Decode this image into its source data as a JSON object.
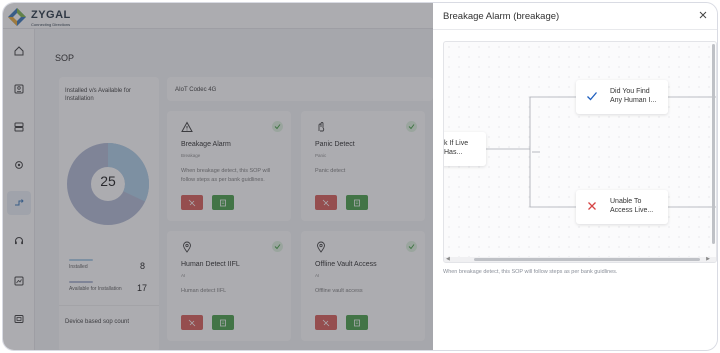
{
  "app": {
    "brand": "ZYGAL",
    "tagline": "Connecting Directions"
  },
  "sidebar": {
    "items": [
      {
        "icon": "home-icon"
      },
      {
        "icon": "id-card-icon"
      },
      {
        "icon": "server-icon"
      },
      {
        "icon": "gear-icon"
      },
      {
        "icon": "workflow-icon",
        "active": true
      },
      {
        "icon": "headset-icon"
      },
      {
        "icon": "report-icon"
      },
      {
        "icon": "device-icon"
      }
    ]
  },
  "main": {
    "title": "SOP",
    "stats": {
      "title": "Installed v/s Available for Installation",
      "total": "25",
      "installed_label": "Installed",
      "installed_value": "8",
      "available_label": "Available for Installation",
      "available_value": "17",
      "installed_fraction": 0.32,
      "installed_color": "#a9cce6",
      "available_color": "#aeb7d2",
      "device_title": "Device based sop count"
    },
    "codec_title": "AIoT Codec 4G",
    "cards": [
      {
        "name": "Breakage Alarm",
        "sub": "Breakage",
        "desc": "When breakage detect, this SOP will follow steps as per bank guidlines.",
        "icon": "warning-icon"
      },
      {
        "name": "Panic Detect",
        "sub": "Panic",
        "desc": "Panic detect",
        "icon": "hand-icon"
      },
      {
        "name": "Human Detect IIFL",
        "sub": "AI",
        "desc": "Human detect IIFL",
        "icon": "location-pin-icon"
      },
      {
        "name": "Offline Vault Access",
        "sub": "AI",
        "desc": "Offline vault access",
        "icon": "location-pin-icon"
      }
    ]
  },
  "drawer": {
    "title": "Breakage Alarm (breakage)",
    "nodes": {
      "left": "k If Live\nHas...",
      "yes": "Did You Find\nAny Human I...",
      "no": "Unable To\nAccess Live..."
    },
    "description": "When breakage detect, this SOP will follow steps as per bank guidlines.",
    "colors": {
      "yes": "#1f5fbf",
      "no": "#d64545"
    }
  }
}
